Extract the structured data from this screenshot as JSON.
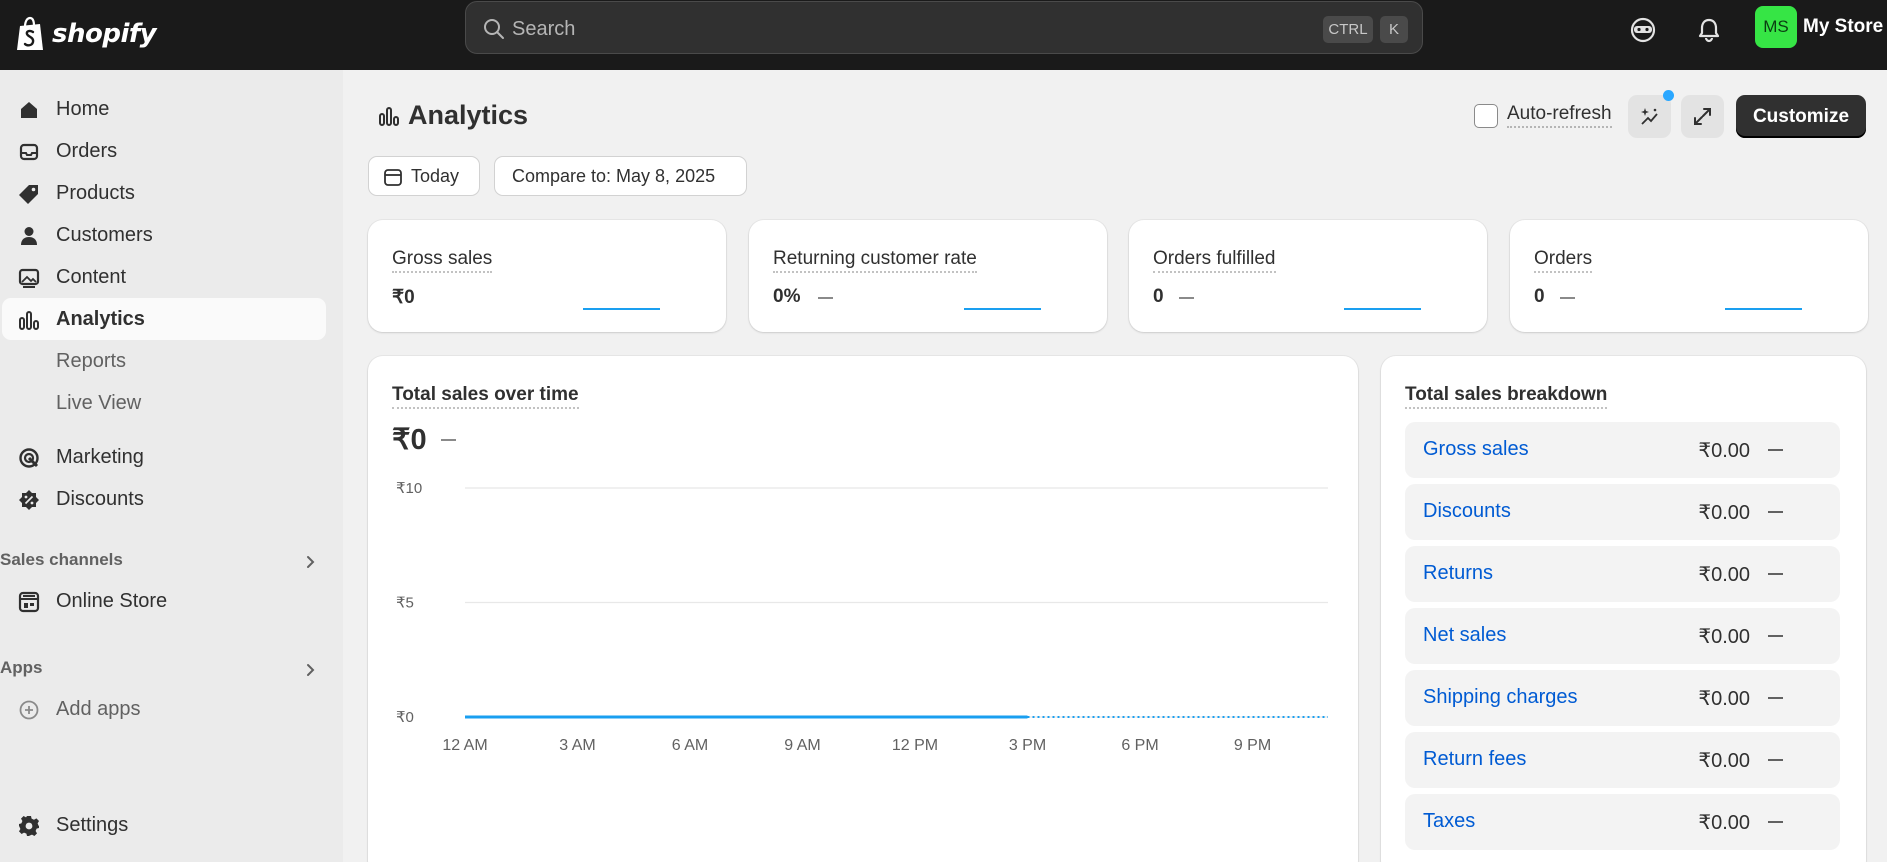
{
  "topbar": {
    "brand": "shopify",
    "search_placeholder": "Search",
    "shortcut_ctrl": "CTRL",
    "shortcut_k": "K",
    "avatar_initials": "MS",
    "store_name": "My Store"
  },
  "sidebar": {
    "items": [
      {
        "label": "Home",
        "icon": "home-icon"
      },
      {
        "label": "Orders",
        "icon": "inbox-icon"
      },
      {
        "label": "Products",
        "icon": "tag-icon"
      },
      {
        "label": "Customers",
        "icon": "person-icon"
      },
      {
        "label": "Content",
        "icon": "image-icon"
      },
      {
        "label": "Analytics",
        "icon": "bar-chart-icon"
      },
      {
        "label": "Reports"
      },
      {
        "label": "Live View"
      },
      {
        "label": "Marketing",
        "icon": "target-icon"
      },
      {
        "label": "Discounts",
        "icon": "discount-icon"
      },
      {
        "label": "Online Store",
        "icon": "store-icon"
      },
      {
        "label": "Add apps",
        "icon": "plus-circle-icon"
      },
      {
        "label": "Settings",
        "icon": "gear-icon"
      }
    ],
    "sales_channels_title": "Sales channels",
    "apps_title": "Apps"
  },
  "page": {
    "title": "Analytics",
    "auto_refresh_label": "Auto-refresh",
    "customize_label": "Customize",
    "date_label": "Today",
    "compare_label": "Compare to: May 8, 2025"
  },
  "metrics": [
    {
      "title": "Gross sales",
      "value": "₹0"
    },
    {
      "title": "Returning customer rate",
      "value": "0%"
    },
    {
      "title": "Orders fulfilled",
      "value": "0"
    },
    {
      "title": "Orders",
      "value": "0"
    }
  ],
  "sales_chart": {
    "title": "Total sales over time",
    "value": "₹0"
  },
  "chart_data": {
    "type": "line",
    "title": "Total sales over time",
    "categories": [
      "12 AM",
      "3 AM",
      "6 AM",
      "9 AM",
      "12 PM",
      "3 PM",
      "6 PM",
      "9 PM"
    ],
    "y_ticks": [
      "₹10",
      "₹5",
      "₹0"
    ],
    "ylim": [
      0,
      10
    ],
    "series": [
      {
        "values": [
          0,
          0,
          0,
          0,
          0,
          0
        ],
        "style": "solid",
        "color": "#1a9ff0"
      },
      {
        "values": [
          0,
          0,
          0
        ],
        "start_index": 5,
        "style": "dotted",
        "color": "#1a9ff0"
      }
    ],
    "grid": true
  },
  "breakdown": {
    "title": "Total sales breakdown",
    "rows": [
      {
        "label": "Gross sales",
        "value": "₹0.00"
      },
      {
        "label": "Discounts",
        "value": "₹0.00"
      },
      {
        "label": "Returns",
        "value": "₹0.00"
      },
      {
        "label": "Net sales",
        "value": "₹0.00"
      },
      {
        "label": "Shipping charges",
        "value": "₹0.00"
      },
      {
        "label": "Return fees",
        "value": "₹0.00"
      },
      {
        "label": "Taxes",
        "value": "₹0.00"
      }
    ]
  },
  "colors": {
    "accent_green": "#36e545",
    "link_blue": "#005bd3",
    "line_blue": "#1a9ff0",
    "notification_dot": "#2aa7ff"
  }
}
